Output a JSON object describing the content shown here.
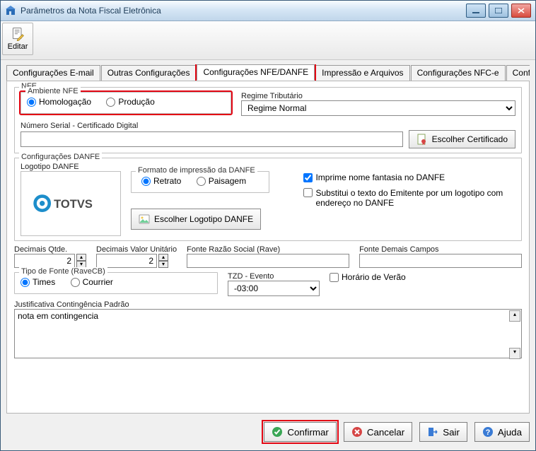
{
  "window": {
    "title": "Parâmetros da Nota Fiscal Eletrônica"
  },
  "toolbar": {
    "editar": "Editar"
  },
  "tabs": [
    "Configurações E-mail",
    "Outras Configurações",
    "Configurações NFE/DANFE",
    "Impressão e Arquivos",
    "Configurações NFC-e",
    "Configuraçõe"
  ],
  "nfe": {
    "legend": "NFE",
    "ambiente": {
      "legend": "Ambiente NFE",
      "options": [
        "Homologação",
        "Produção"
      ],
      "selected": "Homologação"
    },
    "regime": {
      "label": "Regime Tributário",
      "value": "Regime Normal"
    },
    "serial": {
      "label": "Número Serial - Certificado Digital",
      "value": "",
      "button": "Escolher Certificado"
    }
  },
  "danfe": {
    "legend": "Configurações DANFE",
    "logo_label": "Logotipo DANFE",
    "logo_text": "TOTVS",
    "formato": {
      "legend": "Formato de impressão da DANFE",
      "options": [
        "Retrato",
        "Paisagem"
      ],
      "selected": "Retrato"
    },
    "logo_button": "Escolher Logotipo DANFE",
    "chk_fantasia": "Imprime nome fantasia no DANFE",
    "chk_substitui": "Substitui o texto do Emitente por um logotipo com endereço no DANFE"
  },
  "fields": {
    "dec_qtde": {
      "label": "Decimais Qtde.",
      "value": "2"
    },
    "dec_valor": {
      "label": "Decimais Valor Unitário",
      "value": "2"
    },
    "fonte_razao": {
      "label": "Fonte Razão Social (Rave)",
      "value": ""
    },
    "fonte_demais": {
      "label": "Fonte Demais Campos",
      "value": ""
    }
  },
  "tipo_fonte": {
    "legend": "Tipo de Fonte (RaveCB)",
    "options": [
      "Times",
      "Courrier"
    ],
    "selected": "Times"
  },
  "tzd": {
    "label": "TZD - Evento",
    "value": "-03:00",
    "dst_label": "Horário de Verão",
    "dst": false
  },
  "justificativa": {
    "label": "Justificativa Contingência Padrão",
    "value": "nota em contingencia"
  },
  "buttons": {
    "confirmar": "Confirmar",
    "cancelar": "Cancelar",
    "sair": "Sair",
    "ajuda": "Ajuda"
  }
}
